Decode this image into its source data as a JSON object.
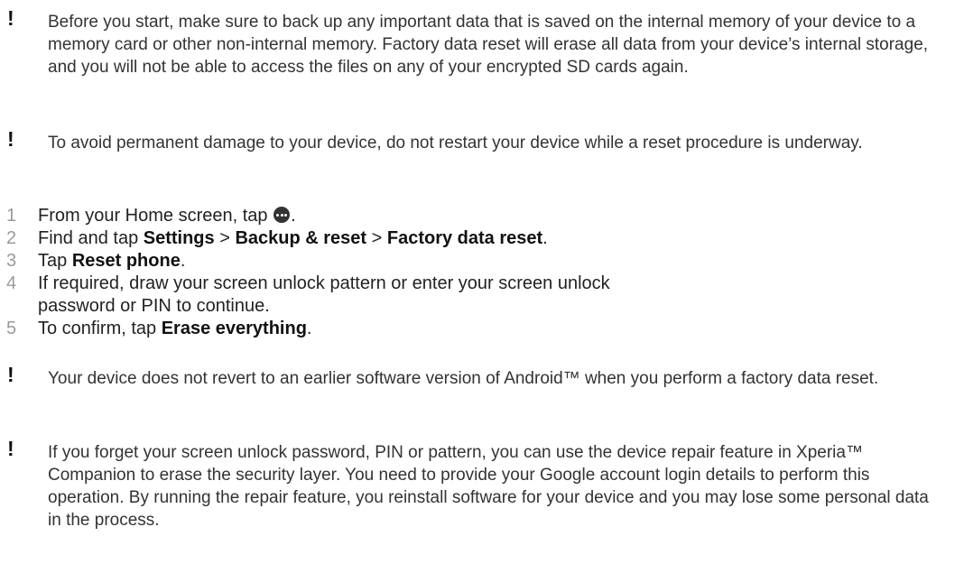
{
  "notes_top": [
    "Before you start, make sure to back up any important data that is saved on the internal memory of your device to a memory card or other non-internal memory. Factory data reset will erase all data from your device’s internal storage, and you will not be able to access the files on any of your encrypted SD cards again.",
    "To avoid permanent damage to your device, do not restart your device while a reset procedure is underway."
  ],
  "steps": [
    {
      "num": "1",
      "text_before": "From your Home screen, tap ",
      "icon": "apps-icon",
      "text_after": "."
    },
    {
      "num": "2",
      "prefix": "Find and tap ",
      "b1": "Settings",
      "sep1": " > ",
      "b2": "Backup & reset",
      "sep2": " > ",
      "b3": "Factory data reset",
      "suffix": "."
    },
    {
      "num": "3",
      "prefix": "Tap ",
      "b1": "Reset phone",
      "suffix": "."
    },
    {
      "num": "4",
      "text": "If required, draw your screen unlock pattern or enter your screen unlock password or PIN to continue."
    },
    {
      "num": "5",
      "prefix": "To confirm, tap ",
      "b1": "Erase everything",
      "suffix": "."
    }
  ],
  "notes_bottom": [
    "Your device does not revert to an earlier software version of Android™ when you perform a factory data reset.",
    "If you forget your screen unlock password, PIN or pattern, you can use the device repair feature in Xperia™ Companion to erase the security layer. You need to provide your Google account login details to perform this operation. By running the repair feature, you reinstall software for your device and you may lose some personal data in the process."
  ],
  "note_marker": "!"
}
